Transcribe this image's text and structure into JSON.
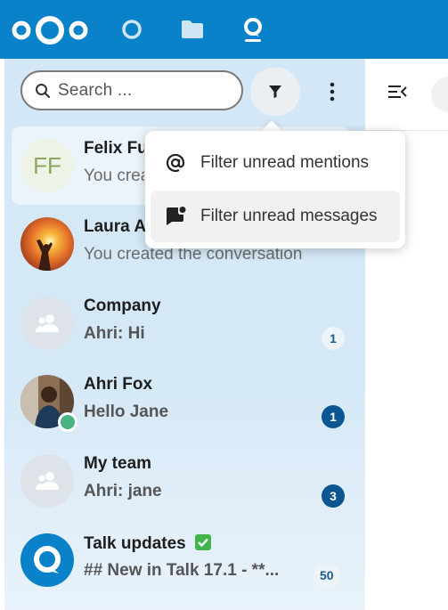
{
  "topbar": {
    "bg_color": "#0a82c9",
    "apps": [
      {
        "icon": "activity-circle-icon"
      },
      {
        "icon": "files-folder-icon"
      },
      {
        "icon": "talk-icon"
      }
    ]
  },
  "search": {
    "placeholder": "Search ..."
  },
  "filter_menu": {
    "items": [
      {
        "label": "Filter unread mentions",
        "icon": "at-icon"
      },
      {
        "label": "Filter unread messages",
        "icon": "message-unread-icon"
      }
    ]
  },
  "conversations": [
    {
      "name": "Felix Fu",
      "subtitle": "You crea",
      "avatar_initials": "FF",
      "badge": ""
    },
    {
      "name": "Laura A",
      "subtitle": "You created the conversation",
      "badge": ""
    },
    {
      "name": "Company",
      "subtitle": "Ahri: Hi",
      "badge": "1",
      "badge_style": "light"
    },
    {
      "name": "Ahri Fox",
      "subtitle": "Hello Jane",
      "badge": "1",
      "badge_style": "dark"
    },
    {
      "name": "My team",
      "subtitle": "Ahri: jane",
      "badge": "3",
      "badge_style": "dark"
    },
    {
      "name": "Talk updates",
      "subtitle": "## New in Talk 17.1 - **...",
      "badge": "50",
      "badge_style": "light"
    }
  ]
}
